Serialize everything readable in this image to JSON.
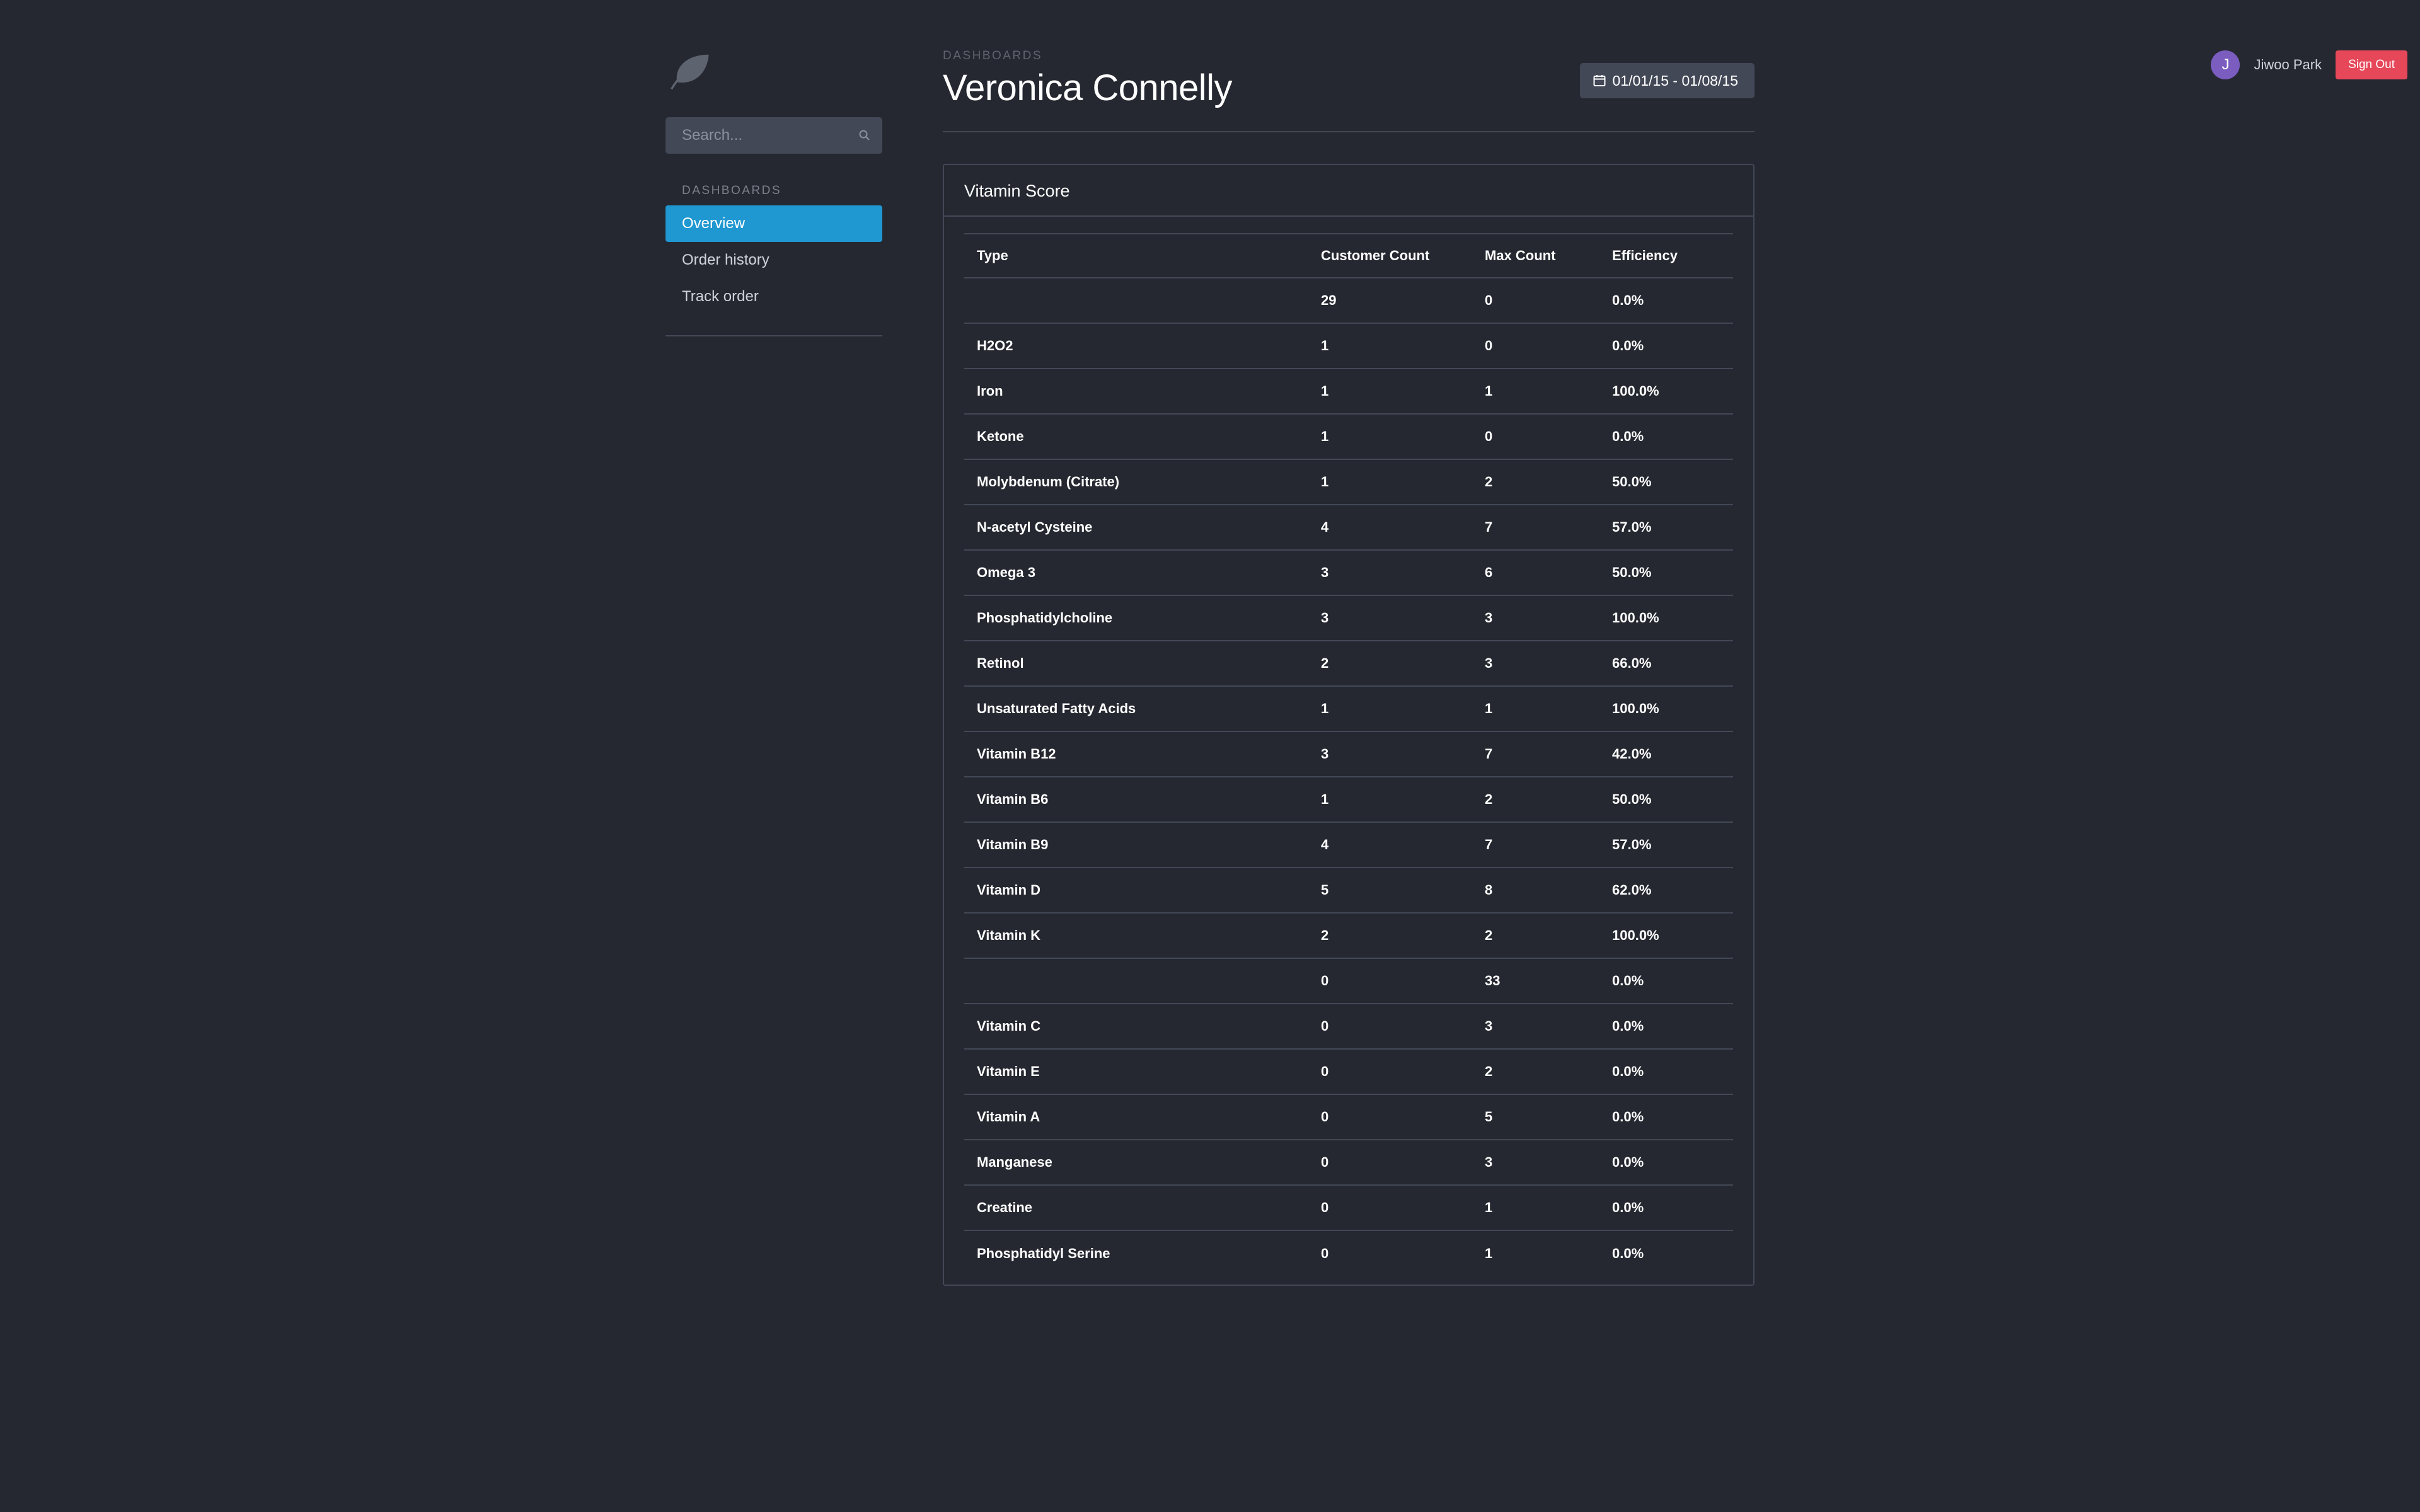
{
  "brand": {
    "logo_icon": "leaf-icon"
  },
  "sidebar": {
    "search_placeholder": "Search...",
    "section_label": "Dashboards",
    "items": [
      {
        "label": "Overview",
        "active": true
      },
      {
        "label": "Order history",
        "active": false
      },
      {
        "label": "Track order",
        "active": false
      }
    ]
  },
  "header": {
    "eyebrow": "Dashboards",
    "title": "Veronica Connelly",
    "date_range": "01/01/15 - 01/08/15"
  },
  "user": {
    "initial": "J",
    "name": "Jiwoo Park",
    "signout_label": "Sign Out"
  },
  "panel": {
    "title": "Vitamin Score",
    "columns": [
      "Type",
      "Customer Count",
      "Max Count",
      "Efficiency"
    ],
    "rows": [
      [
        "",
        "29",
        "0",
        "0.0%"
      ],
      [
        "H2O2",
        "1",
        "0",
        "0.0%"
      ],
      [
        "Iron",
        "1",
        "1",
        "100.0%"
      ],
      [
        "Ketone",
        "1",
        "0",
        "0.0%"
      ],
      [
        "Molybdenum (Citrate)",
        "1",
        "2",
        "50.0%"
      ],
      [
        "N-acetyl Cysteine",
        "4",
        "7",
        "57.0%"
      ],
      [
        "Omega 3",
        "3",
        "6",
        "50.0%"
      ],
      [
        "Phosphatidylcholine",
        "3",
        "3",
        "100.0%"
      ],
      [
        "Retinol",
        "2",
        "3",
        "66.0%"
      ],
      [
        "Unsaturated Fatty Acids",
        "1",
        "1",
        "100.0%"
      ],
      [
        "Vitamin B12",
        "3",
        "7",
        "42.0%"
      ],
      [
        "Vitamin B6",
        "1",
        "2",
        "50.0%"
      ],
      [
        "Vitamin B9",
        "4",
        "7",
        "57.0%"
      ],
      [
        "Vitamin D",
        "5",
        "8",
        "62.0%"
      ],
      [
        "Vitamin K",
        "2",
        "2",
        "100.0%"
      ],
      [
        "",
        "0",
        "33",
        "0.0%"
      ],
      [
        "Vitamin C",
        "0",
        "3",
        "0.0%"
      ],
      [
        "Vitamin E",
        "0",
        "2",
        "0.0%"
      ],
      [
        "Vitamin A",
        "0",
        "5",
        "0.0%"
      ],
      [
        "Manganese",
        "0",
        "3",
        "0.0%"
      ],
      [
        "Creatine",
        "0",
        "1",
        "0.0%"
      ],
      [
        "Phosphatidyl Serine",
        "0",
        "1",
        "0.0%"
      ]
    ]
  },
  "colors": {
    "background": "#252830",
    "border": "#434857",
    "accent": "#1f97d1",
    "danger": "#e64759",
    "avatar": "#7b5dc0"
  }
}
